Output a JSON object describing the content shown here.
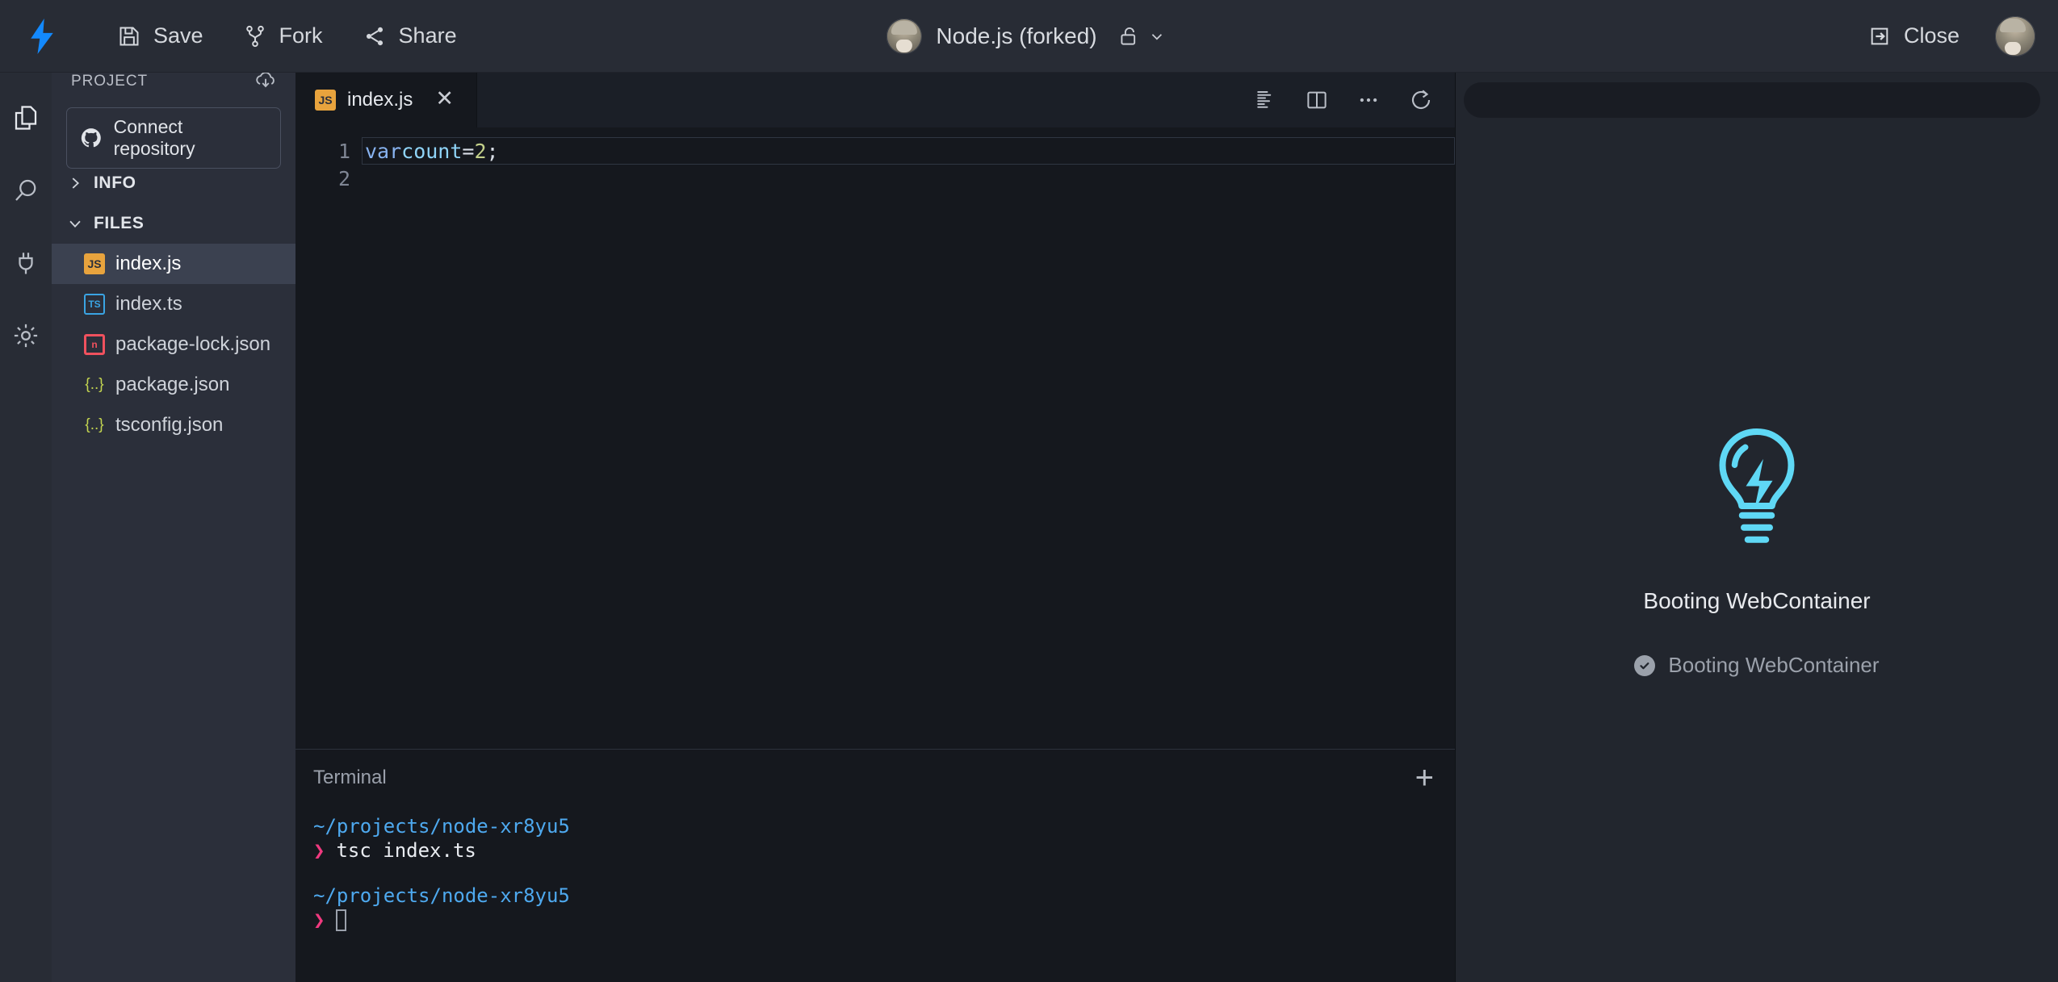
{
  "header": {
    "logo_icon": "lightning-bolt-logo",
    "actions": [
      {
        "label": "Save",
        "icon": "save-disk-icon"
      },
      {
        "label": "Fork",
        "icon": "fork-branch-icon"
      },
      {
        "label": "Share",
        "icon": "share-nodes-icon"
      }
    ],
    "project_title": "Node.js (forked)",
    "lock_icon": "unlocked-padlock-icon",
    "chevron_icon": "chevron-down-icon",
    "close_label": "Close",
    "close_icon": "exit-arrow-icon",
    "avatar_icon": "user-avatar"
  },
  "activitybar": {
    "items": [
      {
        "name": "files",
        "icon": "copy-files-icon"
      },
      {
        "name": "search",
        "icon": "magnifier-search-icon"
      },
      {
        "name": "connect",
        "icon": "plug-icon"
      },
      {
        "name": "settings",
        "icon": "gear-icon"
      }
    ]
  },
  "sidebar": {
    "title": "PROJECT",
    "download_icon": "cloud-download-icon",
    "connect_repo_label": "Connect repository",
    "github_icon": "github-icon",
    "sections": [
      {
        "label": "INFO",
        "expanded": false,
        "chevron": "chevron-right-icon"
      },
      {
        "label": "FILES",
        "expanded": true,
        "chevron": "chevron-down-icon"
      }
    ],
    "files": [
      {
        "name": "index.js",
        "icon": "js-file-icon",
        "icon_text": "JS",
        "icon_class": "fi-js",
        "active": true
      },
      {
        "name": "index.ts",
        "icon": "ts-file-icon",
        "icon_text": "TS",
        "icon_class": "fi-ts",
        "active": false
      },
      {
        "name": "package-lock.json",
        "icon": "npm-lock-file-icon",
        "icon_text": "n",
        "icon_class": "fi-lock",
        "active": false
      },
      {
        "name": "package.json",
        "icon": "json-file-icon",
        "icon_text": "{..}",
        "icon_class": "fi-json",
        "active": false
      },
      {
        "name": "tsconfig.json",
        "icon": "json-file-icon",
        "icon_text": "{..}",
        "icon_class": "fi-json",
        "active": false
      }
    ]
  },
  "editor": {
    "tab": {
      "label": "index.js",
      "icon_text": "JS",
      "close_icon": "close-x-icon"
    },
    "tools": [
      {
        "name": "format-prettier",
        "icon": "prettier-format-icon"
      },
      {
        "name": "split-editor",
        "icon": "split-panes-icon"
      },
      {
        "name": "more-options",
        "icon": "ellipsis-icon"
      },
      {
        "name": "reload",
        "icon": "reload-circular-arrow-icon"
      }
    ],
    "lines": [
      {
        "number": "1",
        "current": true,
        "tokens": [
          {
            "text": "var",
            "type": "kw"
          },
          {
            "text": " ",
            "type": "op"
          },
          {
            "text": "count",
            "type": "var"
          },
          {
            "text": " = ",
            "type": "op"
          },
          {
            "text": "2",
            "type": "num"
          },
          {
            "text": ";",
            "type": "punc"
          }
        ]
      },
      {
        "number": "2",
        "current": false,
        "tokens": []
      }
    ]
  },
  "terminal": {
    "title": "Terminal",
    "add_icon": "plus-icon",
    "entries": [
      {
        "path": "~/projects/node-xr8yu5",
        "prompt": "❯",
        "command": "tsc index.ts",
        "cursor": false
      },
      {
        "path": "~/projects/node-xr8yu5",
        "prompt": "❯",
        "command": "",
        "cursor": true
      }
    ]
  },
  "preview": {
    "url_value": "",
    "url_placeholder": "",
    "bulb_icon": "lightbulb-bolt-icon",
    "boot_title": "Booting WebContainer",
    "status": {
      "icon": "check-circle-icon",
      "label": "Booting WebContainer"
    }
  },
  "colors": {
    "accent_blue": "#1389fd",
    "bulb_cyan": "#5fd8f5",
    "terminal_path": "#4ea9ef",
    "terminal_prompt": "#f0397f",
    "js_icon": "#e8a33d",
    "ts_icon": "#3aa4e3",
    "lock_icon": "#f0515e",
    "json_icon": "#c3d450",
    "sidebar_bg": "#2b2f3a",
    "editor_bg": "#15181e",
    "header_bg": "#282c35",
    "preview_bg": "#22262e"
  }
}
